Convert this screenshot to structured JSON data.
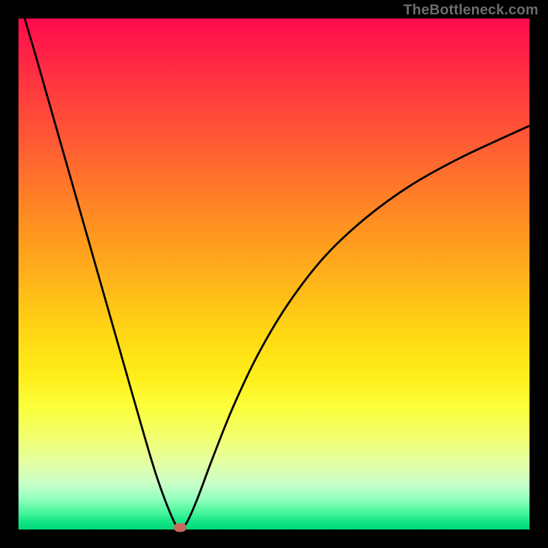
{
  "watermark": "TheBottleneck.com",
  "chart_data": {
    "type": "line",
    "title": "",
    "xlabel": "",
    "ylabel": "",
    "xlim": [
      0,
      100
    ],
    "ylim": [
      0,
      100
    ],
    "grid": false,
    "legend": false,
    "background_gradient": {
      "orientation": "vertical",
      "stops": [
        {
          "pos": 0.0,
          "color": "#ff0a4d"
        },
        {
          "pos": 0.5,
          "color": "#ffc015"
        },
        {
          "pos": 0.78,
          "color": "#f8ff50"
        },
        {
          "pos": 1.0,
          "color": "#00d878"
        }
      ]
    },
    "series": [
      {
        "name": "bottleneck-curve",
        "color": "#000000",
        "stroke_width": 3,
        "x": [
          0,
          3,
          6,
          9,
          12,
          15,
          18,
          21,
          24,
          27,
          30,
          31.5,
          33,
          35,
          38,
          42,
          47,
          53,
          60,
          68,
          77,
          87,
          100
        ],
        "y": [
          104,
          94,
          83.5,
          73,
          62.5,
          52,
          41.5,
          31,
          20.5,
          10.5,
          2.5,
          0.2,
          1.5,
          6,
          14,
          24,
          34.5,
          44.5,
          53.5,
          61,
          67.5,
          73,
          79
        ]
      }
    ],
    "marker": {
      "x": 31.7,
      "y": 0.4,
      "color": "#c96a5e"
    }
  }
}
